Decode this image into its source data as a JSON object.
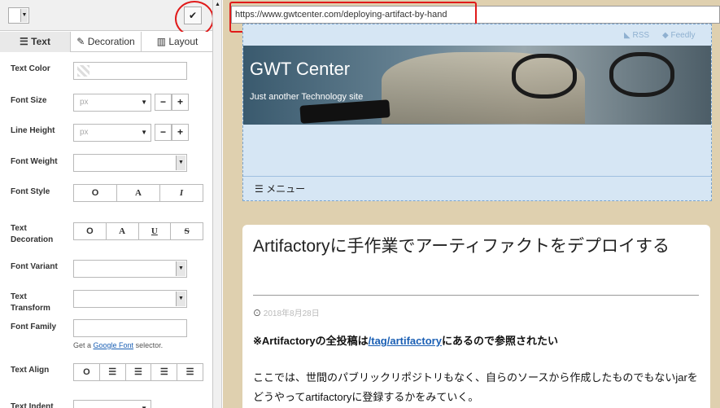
{
  "panel": {
    "tabs": [
      {
        "label": "Text",
        "icon": "align-left-icon"
      },
      {
        "label": "Decoration",
        "icon": "brush-icon"
      },
      {
        "label": "Layout",
        "icon": "columns-icon"
      }
    ],
    "fields": {
      "text_color": "Text Color",
      "font_size": "Font Size",
      "font_size_unit": "px",
      "line_height": "Line Height",
      "line_height_unit": "px",
      "font_weight": "Font Weight",
      "font_style": "Font Style",
      "text_decoration": "Text Decoration",
      "font_variant": "Font Variant",
      "text_transform": "Text Transform",
      "font_family": "Font Family",
      "text_align": "Text Align",
      "text_indent": "Text Indent"
    },
    "minus": "−",
    "plus": "+",
    "font_style_options": [
      "O",
      "A",
      "I"
    ],
    "decoration_options": [
      "O",
      "A",
      "U",
      "S"
    ],
    "help_prefix": "Get a",
    "help_link": "Google Font",
    "help_suffix": "selector."
  },
  "browser": {
    "url": "https://www.gwtcenter.com/deploying-artifact-by-hand"
  },
  "site": {
    "name": "GWT Center",
    "tagline": "Just another Technology site",
    "rss": "RSS",
    "feedly": "Feedly",
    "menu": "メニュー"
  },
  "article": {
    "title": "Artifactoryに手作業でアーティファクトをデプロイする",
    "date": "2018年8月28日",
    "note_prefix": "※Artifactoryの全投稿は",
    "note_link": "/tag/artifactory",
    "note_suffix": "にあるので参照されたい",
    "body": "ここでは、世間のパブリックリポジトリもなく、自らのソースから作成したものでもないjarをどうやってartifactoryに登録するかをみていく。"
  },
  "colors": {
    "highlight": "#e01a1a",
    "link": "#1a5fb4",
    "page_bg": "#dfd0af",
    "header_bg": "#d6e6f4"
  }
}
